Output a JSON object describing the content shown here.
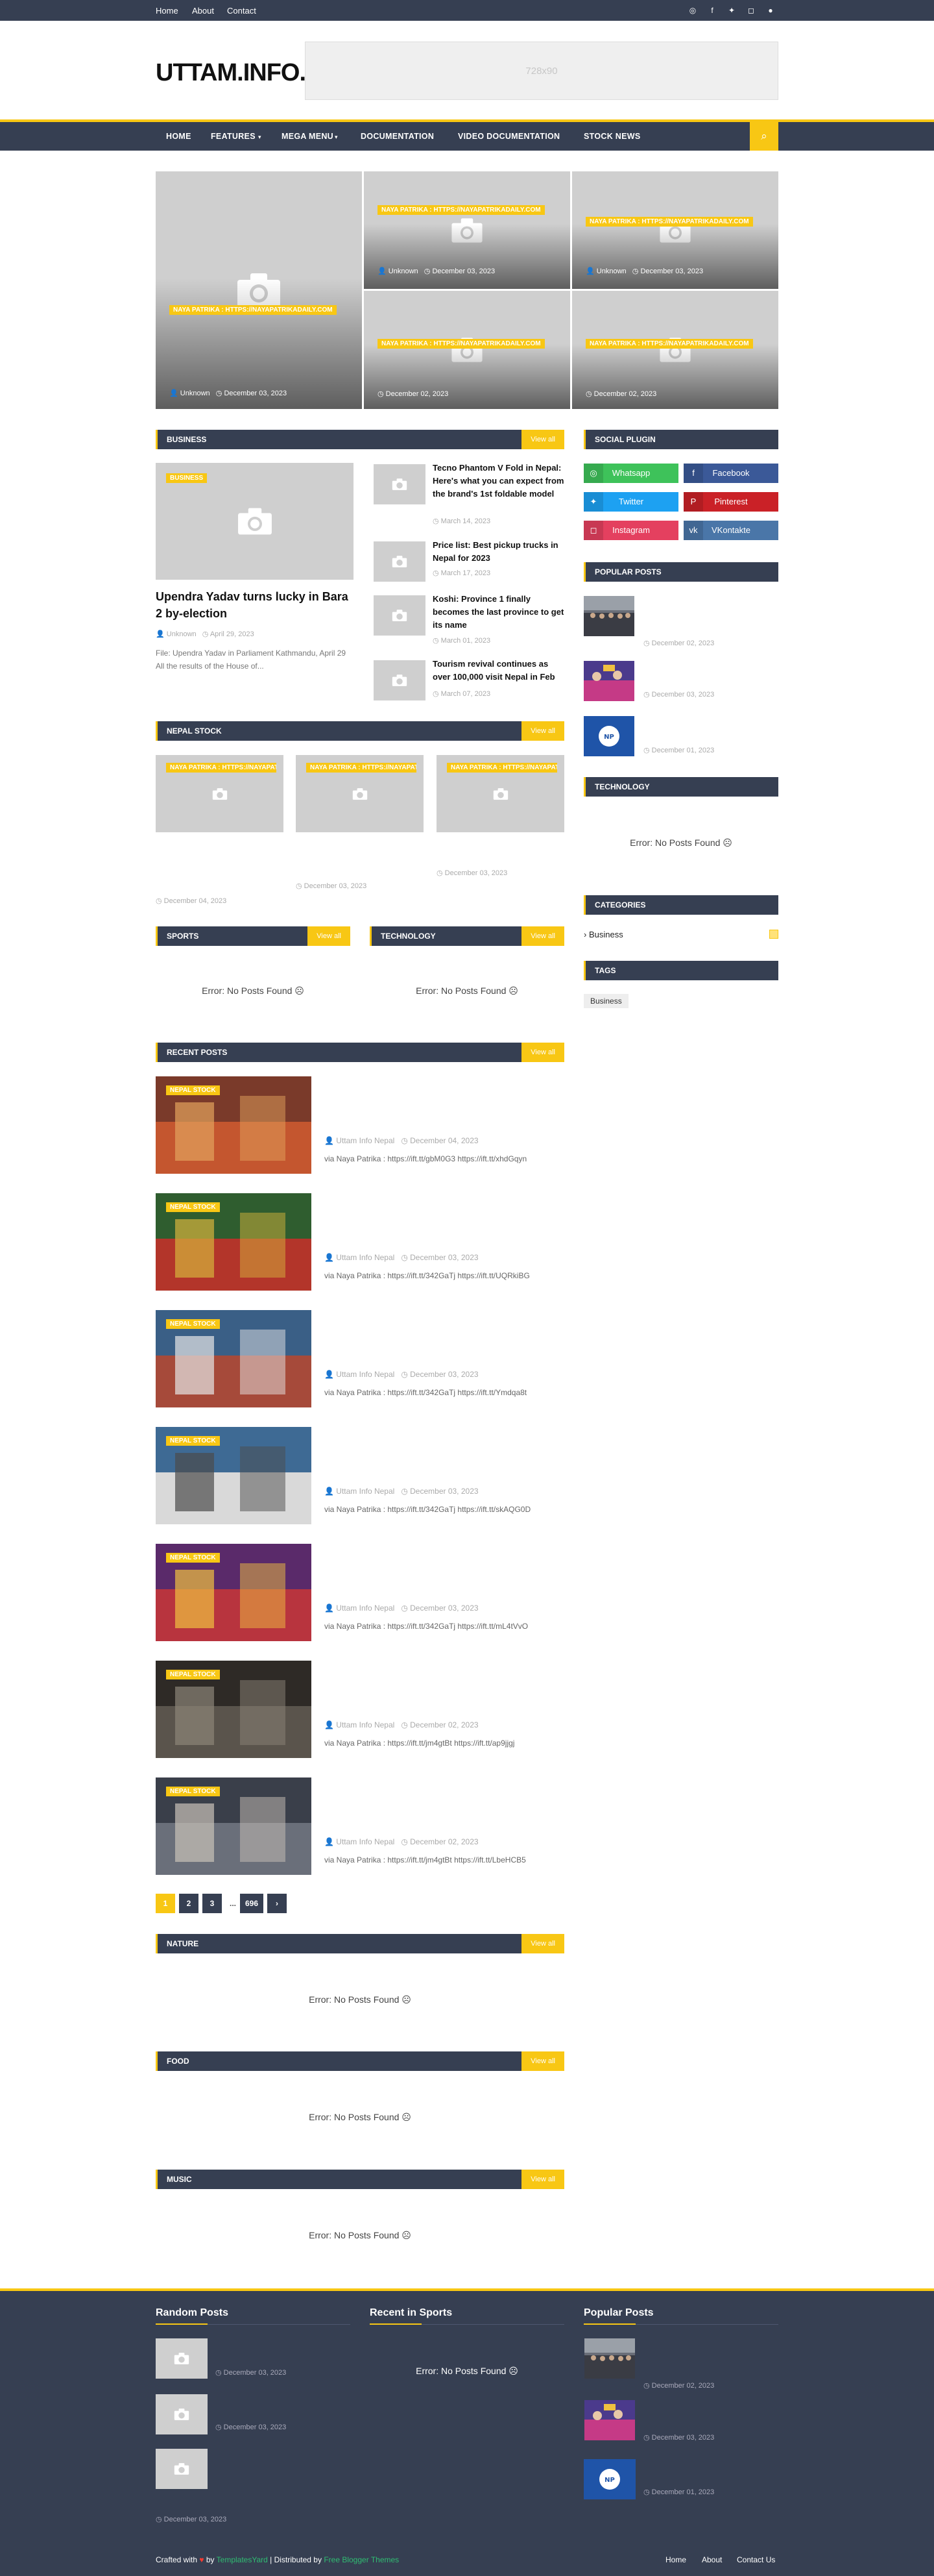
{
  "topbar": {
    "links": [
      "Home",
      "About",
      "Contact"
    ],
    "social_icons": [
      "whatsapp-icon",
      "facebook-icon",
      "twitter-icon",
      "instagram-icon",
      "github-icon"
    ]
  },
  "header": {
    "logo": "UTTAM.INFO.NP",
    "ad_text": "728x90"
  },
  "nav": {
    "items": [
      "HOME",
      "FEATURES",
      "MEGA MENU",
      "DOCUMENTATION",
      "VIDEO DOCUMENTATION",
      "STOCK NEWS"
    ],
    "search_icon": "search-icon"
  },
  "featured": {
    "tag": "NAYA PATRIKA : HTTPS://NAYAPATRIKADAILY.COM",
    "items": [
      {
        "meta": "Unknown",
        "date": "December 03, 2023"
      },
      {
        "meta": "Unknown",
        "date": "December 03, 2023"
      },
      {
        "meta": "Unknown",
        "date": "December 03, 2023"
      },
      {
        "meta": "",
        "date": "December 02, 2023"
      },
      {
        "meta": "",
        "date": "December 02, 2023"
      }
    ]
  },
  "business": {
    "heading": "BUSINESS",
    "view_all": "View all",
    "main": {
      "tag": "BUSINESS",
      "title": "Upendra Yadav turns lucky in Bara 2 by-election",
      "author": "Unknown",
      "date": "April 29, 2023",
      "summary": "File: Upendra Yadav in Parliament Kathmandu, April 29 All the results of the House of..."
    },
    "list": [
      {
        "title": "Tecno Phantom V Fold in Nepal: Here's what you can expect from the brand's 1st foldable model",
        "date": "March 14, 2023"
      },
      {
        "title": "Price list: Best pickup trucks in Nepal for 2023",
        "date": "March 17, 2023"
      },
      {
        "title": "Koshi: Province 1 finally becomes the last province to get its name",
        "date": "March 01, 2023"
      },
      {
        "title": "Tourism revival continues as over 100,000 visit Nepal in Feb",
        "date": "March 07, 2023"
      }
    ]
  },
  "nepal_stock": {
    "heading": "NEPAL STOCK",
    "view_all": "View all",
    "tag": "NAYA PATRIKA : HTTPS://NAYAPATRIKADAILY.COM",
    "dates": [
      "December 04, 2023",
      "December 03, 2023",
      "December 03, 2023"
    ]
  },
  "sports": {
    "heading": "SPORTS",
    "view_all": "View all",
    "error": "Error: No Posts Found"
  },
  "technology_left": {
    "heading": "TECHNOLOGY",
    "view_all": "View all",
    "error": "Error: No Posts Found"
  },
  "recent": {
    "heading": "RECENT POSTS",
    "view_all": "View all",
    "tag": "NEPAL STOCK",
    "author": "Uttam Info Nepal",
    "items": [
      {
        "date": "December 04, 2023",
        "summary": "via Naya Patrika : https://ift.tt/gbM0G3 https://ift.tt/xhdGqyn"
      },
      {
        "date": "December 03, 2023",
        "summary": "via Naya Patrika : https://ift.tt/342GaTj https://ift.tt/UQRkiBG"
      },
      {
        "date": "December 03, 2023",
        "summary": "via Naya Patrika : https://ift.tt/342GaTj https://ift.tt/Ymdqa8t"
      },
      {
        "date": "December 03, 2023",
        "summary": "via Naya Patrika : https://ift.tt/342GaTj https://ift.tt/skAQG0D"
      },
      {
        "date": "December 03, 2023",
        "summary": "via Naya Patrika : https://ift.tt/342GaTj https://ift.tt/mL4tVvO"
      },
      {
        "date": "December 02, 2023",
        "summary": "via Naya Patrika : https://ift.tt/jm4gtBt https://ift.tt/ap9jjgj"
      },
      {
        "date": "December 02, 2023",
        "summary": "via Naya Patrika : https://ift.tt/jm4gtBt https://ift.tt/LbeHCB5"
      }
    ]
  },
  "pagination": {
    "pages": [
      "1",
      "2",
      "3",
      "...",
      "696",
      "›"
    ]
  },
  "nature": {
    "heading": "NATURE",
    "view_all": "View all",
    "error": "Error: No Posts Found"
  },
  "food": {
    "heading": "FOOD",
    "view_all": "View all",
    "error": "Error: No Posts Found"
  },
  "music": {
    "heading": "MUSIC",
    "view_all": "View all",
    "error": "Error: No Posts Found"
  },
  "sidebar": {
    "social_heading": "SOCIAL PLUGIN",
    "social": [
      {
        "name": "Whatsapp",
        "color": "#3ec25a",
        "icon": "whatsapp-icon"
      },
      {
        "name": "Facebook",
        "color": "#3b5998",
        "icon": "facebook-icon"
      },
      {
        "name": "Twitter",
        "color": "#1da1f2",
        "icon": "twitter-icon"
      },
      {
        "name": "Pinterest",
        "color": "#ca2127",
        "icon": "pinterest-icon"
      },
      {
        "name": "Instagram",
        "color": "#e4405f",
        "icon": "instagram-icon"
      },
      {
        "name": "VKontakte",
        "color": "#4a76a8",
        "icon": "vk-icon"
      }
    ],
    "popular_heading": "POPULAR POSTS",
    "popular_dates": [
      "December 02, 2023",
      "December 03, 2023",
      "December 01, 2023"
    ],
    "technology_heading": "TECHNOLOGY",
    "technology_error": "Error: No Posts Found",
    "categories_heading": "CATEGORIES",
    "categories": [
      "Business"
    ],
    "tags_heading": "TAGS",
    "tags": [
      "Business"
    ]
  },
  "footer": {
    "random_heading": "Random Posts",
    "random_dates": [
      "December 03, 2023",
      "December 03, 2023",
      "December 03, 2023"
    ],
    "sports_heading": "Recent in Sports",
    "sports_error": "Error: No Posts Found",
    "popular_heading": "Popular Posts",
    "popular_dates": [
      "December 02, 2023",
      "December 03, 2023",
      "December 01, 2023"
    ],
    "copyright_crafted": "Crafted with",
    "copyright_by": "by",
    "copyright_author": "TemplatesYard",
    "copyright_dist": "| Distributed by",
    "copyright_dist_name": "Free Blogger Themes",
    "links": [
      "Home",
      "About",
      "Contact Us"
    ]
  },
  "colors": {
    "accent": "#f8c714",
    "dark": "#363f52",
    "link_green": "#2fbd72",
    "heart": "#ff3b30"
  }
}
